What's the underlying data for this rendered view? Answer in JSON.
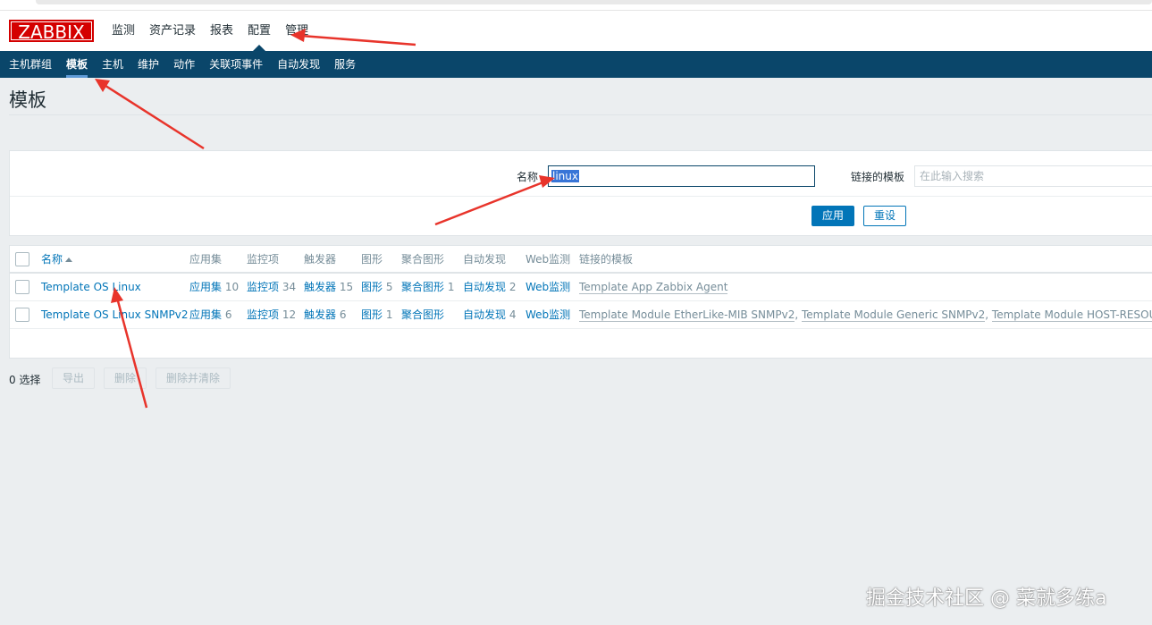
{
  "logo": "ZABBIX",
  "top_menu": [
    "监测",
    "资产记录",
    "报表",
    "配置",
    "管理"
  ],
  "top_menu_active": "配置",
  "sub_menu": [
    "主机群组",
    "模板",
    "主机",
    "维护",
    "动作",
    "关联项事件",
    "自动发现",
    "服务"
  ],
  "sub_menu_active": "模板",
  "page_title": "模板",
  "filter": {
    "name_label": "名称",
    "name_value": "linux",
    "linked_label": "链接的模板",
    "linked_placeholder": "在此输入搜索",
    "apply_label": "应用",
    "reset_label": "重设"
  },
  "table": {
    "headers": {
      "name": "名称",
      "apps": "应用集",
      "items": "监控项",
      "triggers": "触发器",
      "graphs": "图形",
      "screens": "聚合图形",
      "discovery": "自动发现",
      "web": "Web监测",
      "linked": "链接的模板"
    },
    "rows": [
      {
        "name": "Template OS Linux",
        "apps_label": "应用集",
        "apps_count": "10",
        "items_label": "监控项",
        "items_count": "34",
        "triggers_label": "触发器",
        "triggers_count": "15",
        "graphs_label": "图形",
        "graphs_count": "5",
        "screens_label": "聚合图形",
        "screens_count": "1",
        "discovery_label": "自动发现",
        "discovery_count": "2",
        "web_label": "Web监测",
        "linked": [
          "Template App Zabbix Agent"
        ]
      },
      {
        "name": "Template OS Linux SNMPv2",
        "apps_label": "应用集",
        "apps_count": "6",
        "items_label": "监控项",
        "items_count": "12",
        "triggers_label": "触发器",
        "triggers_count": "6",
        "graphs_label": "图形",
        "graphs_count": "1",
        "screens_label": "聚合图形",
        "screens_count": "",
        "discovery_label": "自动发现",
        "discovery_count": "4",
        "web_label": "Web监测",
        "linked": [
          "Template Module EtherLike-MIB SNMPv2",
          "Template Module Generic SNMPv2",
          "Template Module HOST-RESOURCES-M"
        ]
      }
    ]
  },
  "footer": {
    "selected": "0 选择",
    "export_label": "导出",
    "delete_label": "删除",
    "delete_clear_label": "删除并清除"
  },
  "watermark": "掘金技术社区 @ 菜就多练a",
  "colors": {
    "brand": "#d40000",
    "nav": "#0a466a",
    "link": "#0275b8",
    "annotation": "#e8342b"
  }
}
